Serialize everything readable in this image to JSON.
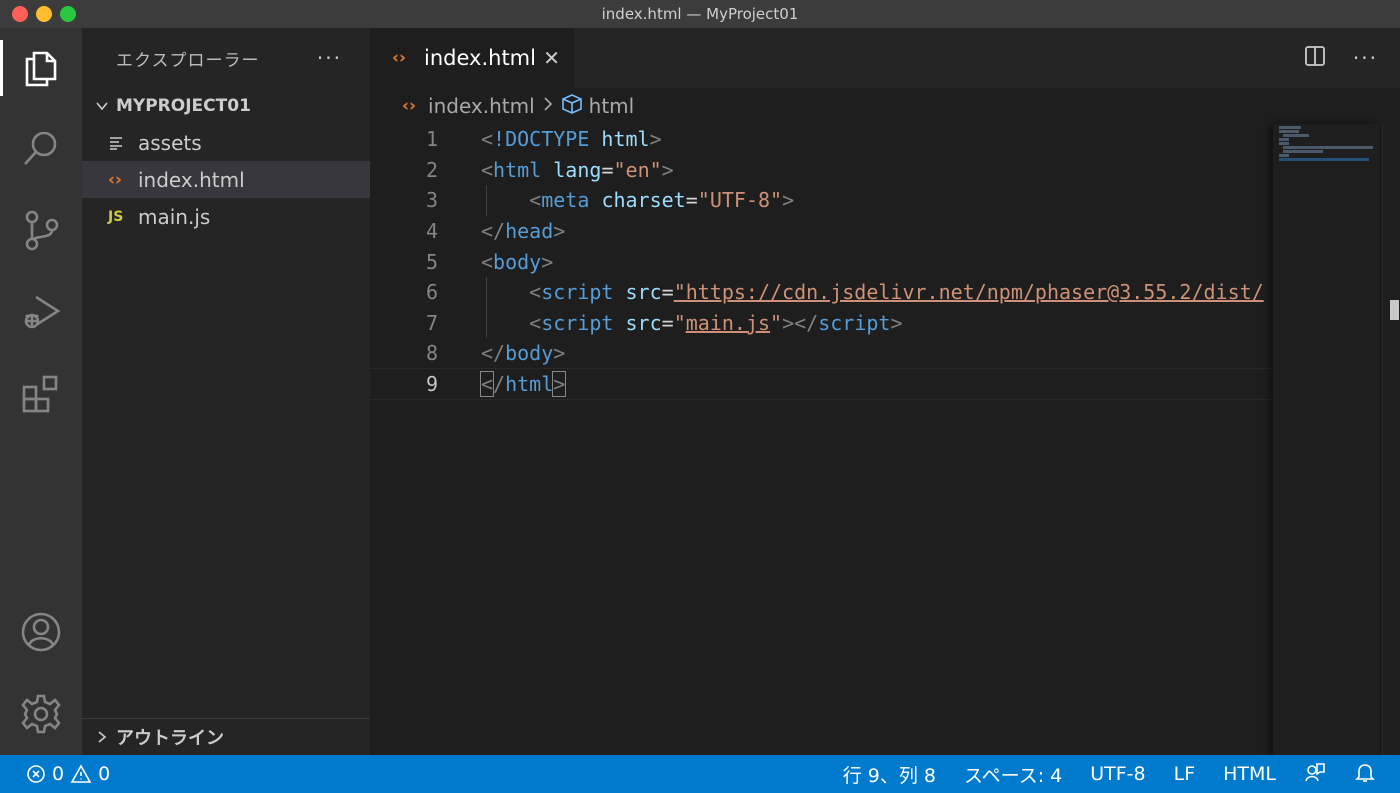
{
  "window": {
    "title": "index.html — MyProject01"
  },
  "sidebar": {
    "header": "エクスプローラー",
    "more": "···",
    "project": "MYPROJECT01",
    "files": [
      {
        "name": "assets",
        "icon": "list-icon"
      },
      {
        "name": "index.html",
        "icon": "html-file-icon",
        "selected": true
      },
      {
        "name": "main.js",
        "icon": "js-file-icon",
        "badge": "JS"
      }
    ],
    "outline": "アウトライン"
  },
  "tabs": [
    {
      "label": "index.html",
      "active": true
    }
  ],
  "breadcrumb": {
    "file": "index.html",
    "symbol": "html"
  },
  "code": {
    "current_line": 9,
    "lines": [
      {
        "n": "1"
      },
      {
        "n": "2"
      },
      {
        "n": "3"
      },
      {
        "n": "4"
      },
      {
        "n": "5"
      },
      {
        "n": "6"
      },
      {
        "n": "7"
      },
      {
        "n": "8"
      },
      {
        "n": "9"
      }
    ],
    "tokens": {
      "doctype": "!DOCTYPE",
      "html": "html",
      "lang_attr": "lang",
      "lang_val": "\"en\"",
      "meta": "meta",
      "charset_attr": "charset",
      "charset_val": "\"UTF-8\"",
      "head": "head",
      "body": "body",
      "script": "script",
      "src_attr": "src",
      "cdn_val": "\"https://cdn.jsdelivr.net/npm/phaser@3.55.2/dist/",
      "main_val": "main.js"
    }
  },
  "statusbar": {
    "errors": "0",
    "warnings": "0",
    "position": "行 9、列 8",
    "indent": "スペース: 4",
    "encoding": "UTF-8",
    "eol": "LF",
    "language": "HTML"
  },
  "colors": {
    "accent": "#007acc",
    "html_icon": "#e37933",
    "js_icon": "#cbcb41"
  }
}
